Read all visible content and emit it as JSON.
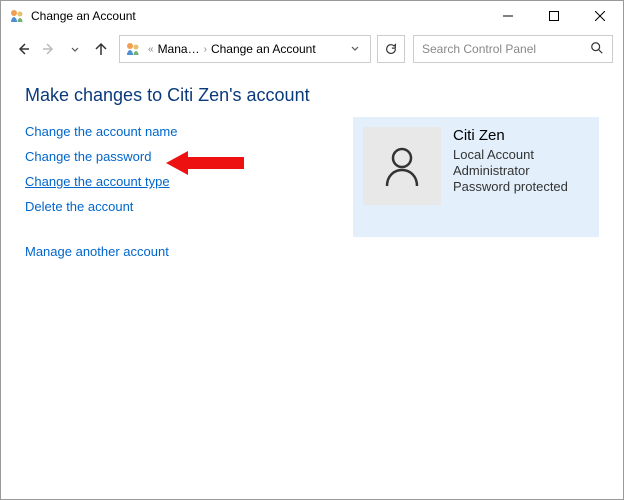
{
  "window": {
    "title": "Change an Account"
  },
  "breadcrumb": {
    "parent": "Mana…",
    "current": "Change an Account"
  },
  "search": {
    "placeholder": "Search Control Panel"
  },
  "main": {
    "heading": "Make changes to Citi Zen's account",
    "links": {
      "change_name": "Change the account name",
      "change_password": "Change the password",
      "change_type": "Change the account type",
      "delete_account": "Delete the account",
      "manage_another": "Manage another account"
    }
  },
  "account": {
    "name": "Citi Zen",
    "type": "Local Account",
    "role": "Administrator",
    "protection": "Password protected"
  }
}
